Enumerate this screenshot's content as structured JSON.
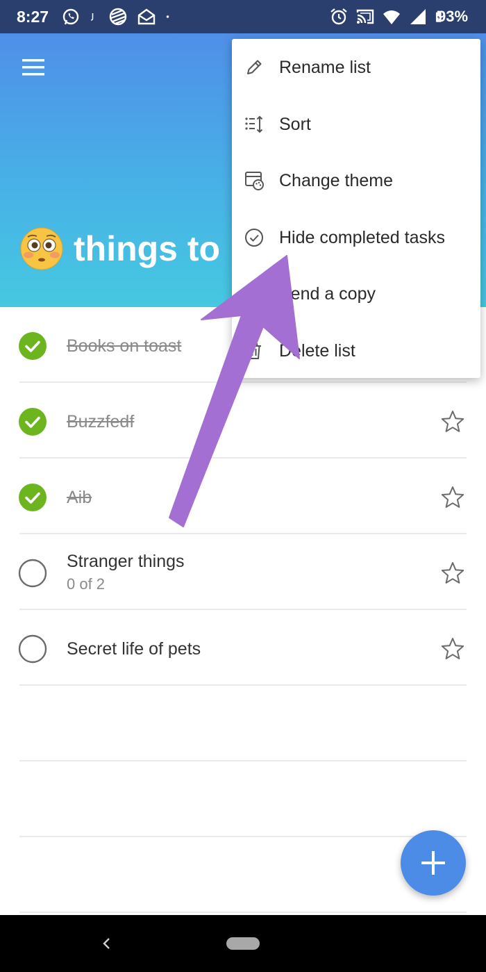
{
  "status_bar": {
    "time": "8:27",
    "battery": "93%",
    "left_icons": [
      "whatsapp-icon",
      "j-app-icon",
      "striped-app-icon",
      "mail-icon",
      "dot-icon"
    ],
    "right_icons": [
      "alarm-icon",
      "cast-icon",
      "wifi-icon",
      "signal-icon",
      "battery-icon"
    ]
  },
  "header": {
    "title": "things to",
    "emoji": "flushed-face-icon",
    "gradient_colors": [
      "#4f8fe8",
      "#46c8e0"
    ]
  },
  "tasks": [
    {
      "title": "Books on toast",
      "completed": true,
      "subtitle": "",
      "star_visible": false
    },
    {
      "title": "Buzzfedf",
      "completed": true,
      "subtitle": "",
      "star_visible": true
    },
    {
      "title": "Aib",
      "completed": true,
      "subtitle": "",
      "star_visible": true
    },
    {
      "title": "Stranger things",
      "completed": false,
      "subtitle": "0 of 2",
      "star_visible": true
    },
    {
      "title": "Secret life of pets",
      "completed": false,
      "subtitle": "",
      "star_visible": true
    }
  ],
  "context_menu": {
    "items": [
      {
        "label": "Rename list",
        "icon": "pencil-icon"
      },
      {
        "label": "Sort",
        "icon": "sort-icon"
      },
      {
        "label": "Change theme",
        "icon": "palette-icon"
      },
      {
        "label": "Hide completed tasks",
        "icon": "check-circle-icon"
      },
      {
        "label": "Send a copy",
        "icon": "share-icon"
      },
      {
        "label": "Delete list",
        "icon": "trash-icon"
      }
    ]
  },
  "fab": {
    "icon": "plus-icon",
    "color": "#4c8ce6"
  },
  "annotation": {
    "type": "arrow",
    "color": "#a36fd2",
    "points_to": "Hide completed tasks"
  },
  "colors": {
    "check_green": "#6cb51e",
    "header_dark_bar": "#2b3f6e"
  }
}
